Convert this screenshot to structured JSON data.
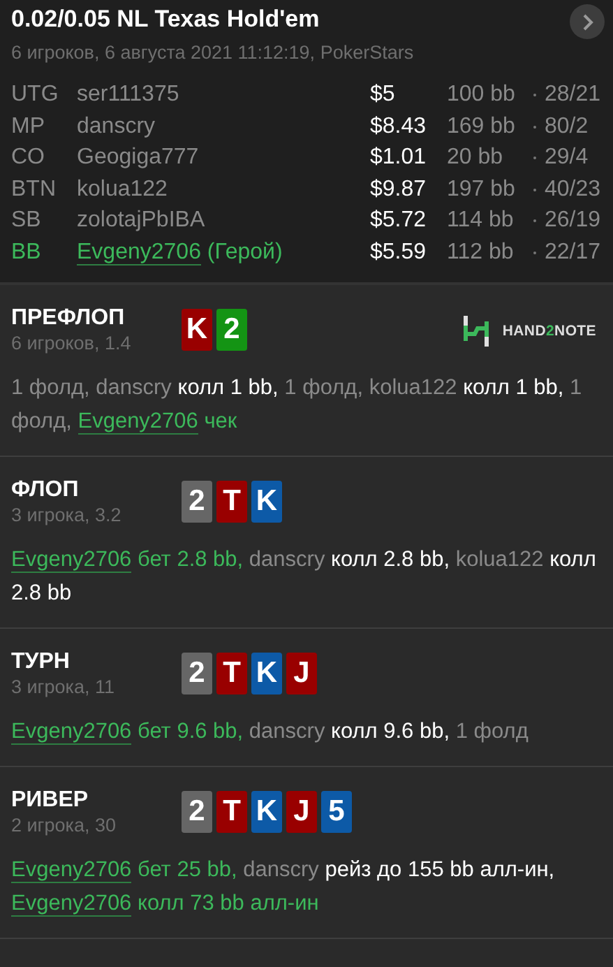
{
  "header": {
    "title": "0.02/0.05 NL Texas Hold'em",
    "subtitle": "6 игроков, 6 августа 2021 11:12:19, PokerStars"
  },
  "players": [
    {
      "position": "UTG",
      "name": "ser111375",
      "hero": false,
      "stack": "$5",
      "bb": "100 bb",
      "stats": "28/21"
    },
    {
      "position": "MP",
      "name": "danscry",
      "hero": false,
      "stack": "$8.43",
      "bb": "169 bb",
      "stats": "80/2"
    },
    {
      "position": "CO",
      "name": "Geogiga777",
      "hero": false,
      "stack": "$1.01",
      "bb": "20 bb",
      "stats": "29/4"
    },
    {
      "position": "BTN",
      "name": "kolua122",
      "hero": false,
      "stack": "$9.87",
      "bb": "197 bb",
      "stats": "40/23"
    },
    {
      "position": "SB",
      "name": "zolotajPbIBA",
      "hero": false,
      "stack": "$5.72",
      "bb": "114 bb",
      "stats": "26/19"
    },
    {
      "position": "BB",
      "name": "Evgeny2706",
      "hero": true,
      "hero_label": "(Герой)",
      "stack": "$5.59",
      "bb": "112 bb",
      "stats": "22/17"
    }
  ],
  "streets": [
    {
      "title": "ПРЕФЛОП",
      "subtitle": "6 игроков, 1.4",
      "logo": {
        "parts": [
          "HAND",
          "2",
          "NOTE"
        ]
      },
      "cards": [
        {
          "rank": "K",
          "color": "#990000"
        },
        {
          "rank": "2",
          "color": "#149414"
        }
      ],
      "actions": [
        {
          "kind": "muted",
          "text": "1 фолд, danscry "
        },
        {
          "kind": "action",
          "text": "колл 1 bb,"
        },
        {
          "kind": "muted",
          "text": " 1 фолд, kolua122 "
        },
        {
          "kind": "action",
          "text": "колл 1 bb,"
        },
        {
          "kind": "muted",
          "text": " 1 фолд, "
        },
        {
          "kind": "hero_link",
          "text": "Evgeny2706"
        },
        {
          "kind": "hero",
          "text": " чек"
        }
      ]
    },
    {
      "title": "ФЛОП",
      "subtitle": "3 игрока, 3.2",
      "cards": [
        {
          "rank": "2",
          "color": "#666666"
        },
        {
          "rank": "T",
          "color": "#990000"
        },
        {
          "rank": "K",
          "color": "#0d5aa7"
        }
      ],
      "actions": [
        {
          "kind": "hero_link",
          "text": "Evgeny2706"
        },
        {
          "kind": "hero",
          "text": " бет 2.8 bb,"
        },
        {
          "kind": "muted",
          "text": " danscry "
        },
        {
          "kind": "action",
          "text": "колл 2.8 bb,"
        },
        {
          "kind": "muted",
          "text": " kolua122 "
        },
        {
          "kind": "action",
          "text": "колл 2.8 bb"
        }
      ]
    },
    {
      "title": "ТУРН",
      "subtitle": "3 игрока, 11",
      "cards": [
        {
          "rank": "2",
          "color": "#666666"
        },
        {
          "rank": "T",
          "color": "#990000"
        },
        {
          "rank": "K",
          "color": "#0d5aa7"
        },
        {
          "rank": "J",
          "color": "#990000"
        }
      ],
      "actions": [
        {
          "kind": "hero_link",
          "text": "Evgeny2706"
        },
        {
          "kind": "hero",
          "text": " бет 9.6 bb,"
        },
        {
          "kind": "muted",
          "text": " danscry "
        },
        {
          "kind": "action",
          "text": "колл 9.6 bb,"
        },
        {
          "kind": "muted",
          "text": " 1 фолд"
        }
      ]
    },
    {
      "title": "РИВЕР",
      "subtitle": "2 игрока, 30",
      "cards": [
        {
          "rank": "2",
          "color": "#666666"
        },
        {
          "rank": "T",
          "color": "#990000"
        },
        {
          "rank": "K",
          "color": "#0d5aa7"
        },
        {
          "rank": "J",
          "color": "#990000"
        },
        {
          "rank": "5",
          "color": "#0d5aa7"
        }
      ],
      "actions": [
        {
          "kind": "hero_link",
          "text": "Evgeny2706"
        },
        {
          "kind": "hero",
          "text": " бет 25 bb,"
        },
        {
          "kind": "muted",
          "text": " danscry "
        },
        {
          "kind": "action",
          "text": "рейз до 155 bb алл-ин,"
        },
        {
          "kind": "break"
        },
        {
          "kind": "hero_link",
          "text": "Evgeny2706"
        },
        {
          "kind": "hero",
          "text": " колл 73 bb алл-ин"
        }
      ]
    }
  ]
}
